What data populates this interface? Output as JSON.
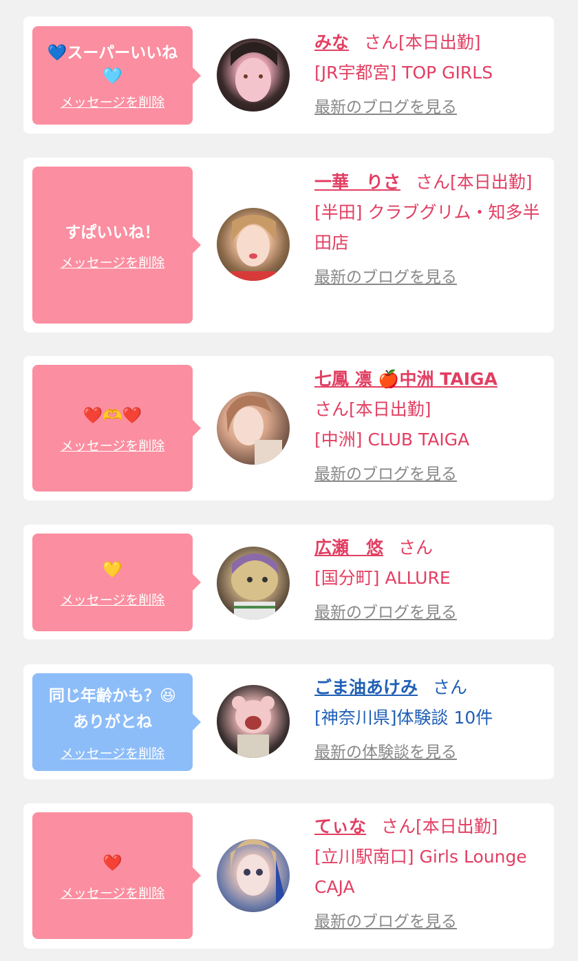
{
  "colors": {
    "pink_bubble": "#fb8ea0",
    "blue_bubble": "#8dbdf9",
    "pink_text": "#e23e62",
    "blue_text": "#1f5fb5",
    "link_gray": "#888888"
  },
  "delete_label": "メッセージを削除",
  "cards": [
    {
      "msg_line1": "💙スーパーいいね",
      "msg_line2": "🩵",
      "name": "みな",
      "suffix": "さん[本日出勤]",
      "shop": "[JR宇都宮] TOP GIRLS",
      "link": "最新のブログを見る"
    },
    {
      "msg_line1": "すぱいいね！",
      "name": "一華　りさ",
      "suffix": "さん[本日出勤]",
      "shop": "[半田] クラブグリム・知多半田店",
      "link": "最新のブログを見る"
    },
    {
      "msg_line1": "❤️🫶❤️",
      "name": "七鳳 凛 🍎中洲 TAIGA",
      "suffix": "さん[本日出勤]",
      "shop": "[中洲] CLUB TAIGA",
      "link": "最新のブログを見る"
    },
    {
      "msg_line1": "💛",
      "name": "広瀬　悠",
      "suffix": "さん",
      "shop": "[国分町] ALLURE",
      "link": "最新のブログを見る"
    },
    {
      "msg_line1": "同じ年齢かも？😆",
      "msg_line2": "ありがとね",
      "name": "ごま油あけみ",
      "suffix": "さん",
      "shop": "[神奈川県]体験談 10件",
      "link": "最新の体験談を見る"
    },
    {
      "msg_line1": "❤️",
      "name": "てぃな",
      "suffix": "さん[本日出勤]",
      "shop": "[立川駅南口] Girls Lounge CAJA",
      "link": "最新のブログを見る"
    }
  ]
}
